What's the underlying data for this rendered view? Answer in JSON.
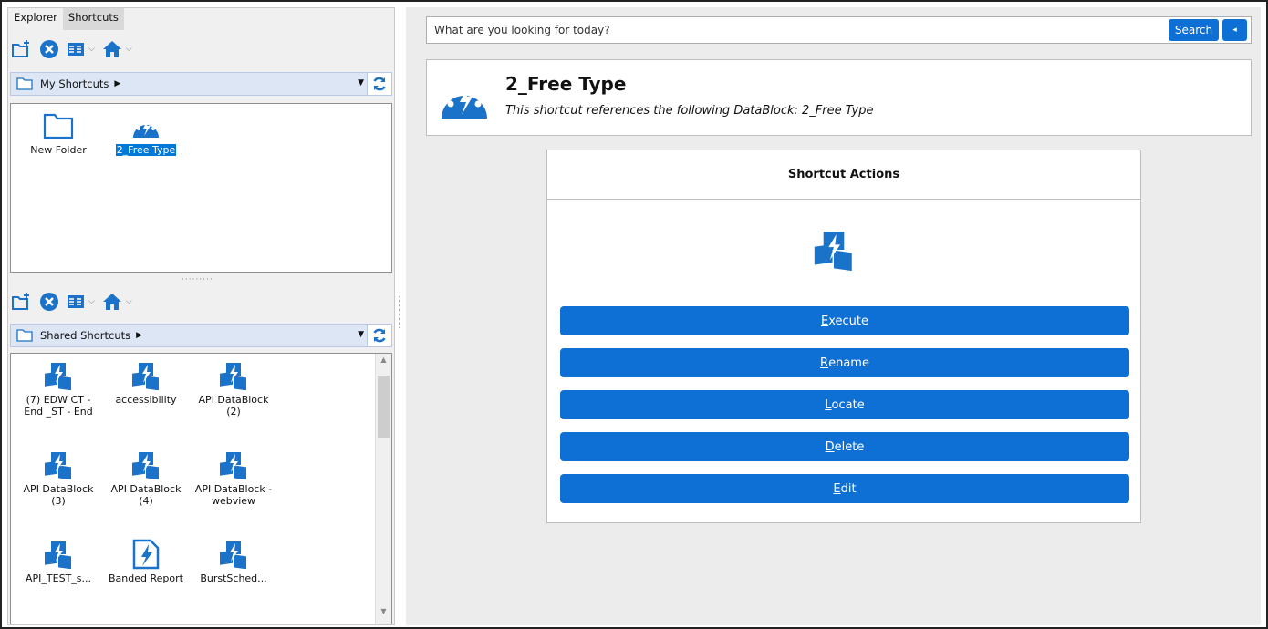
{
  "tabs": [
    "Explorer",
    "Shortcuts"
  ],
  "toolbar_icons": [
    "new-folder-icon",
    "delete-icon",
    "view-icon",
    "home-icon"
  ],
  "my_shortcuts": {
    "path_label": "My Shortcuts",
    "items": [
      {
        "label": "New Folder",
        "icon": "folder-icon"
      },
      {
        "label": "2_Free Type",
        "icon": "free-type-icon",
        "selected": true
      }
    ]
  },
  "shared_shortcuts": {
    "path_label": "Shared Shortcuts",
    "items": [
      {
        "label": "(7) EDW CT - End _ST - End",
        "icon": "datablock-icon"
      },
      {
        "label": "accessibility",
        "icon": "datablock-icon"
      },
      {
        "label": "API DataBlock (2)",
        "icon": "datablock-icon"
      },
      {
        "label": "API DataBlock (3)",
        "icon": "datablock-icon"
      },
      {
        "label": "API DataBlock (4)",
        "icon": "datablock-icon"
      },
      {
        "label": "API DataBlock - webview",
        "icon": "datablock-icon"
      },
      {
        "label": "API_TEST_s...",
        "icon": "datablock-icon"
      },
      {
        "label": "Banded Report",
        "icon": "report-icon"
      },
      {
        "label": "BurstSched...",
        "icon": "datablock-icon"
      }
    ]
  },
  "search": {
    "placeholder": "What are you looking for today?",
    "button_label": "Search",
    "collapse_label": "◂"
  },
  "header": {
    "title": "2_Free Type",
    "subtitle": "This shortcut references the following DataBlock: 2_Free Type"
  },
  "actions": {
    "title": "Shortcut Actions",
    "buttons": [
      {
        "first": "E",
        "rest": "xecute"
      },
      {
        "first": "R",
        "rest": "ename"
      },
      {
        "first": "L",
        "rest": "ocate"
      },
      {
        "first": "D",
        "rest": "elete"
      },
      {
        "first": "E",
        "rest": "dit"
      }
    ]
  },
  "colors": {
    "accent": "#0e6fd4",
    "icon_blue": "#1a73c8",
    "selection": "#0078d7"
  }
}
